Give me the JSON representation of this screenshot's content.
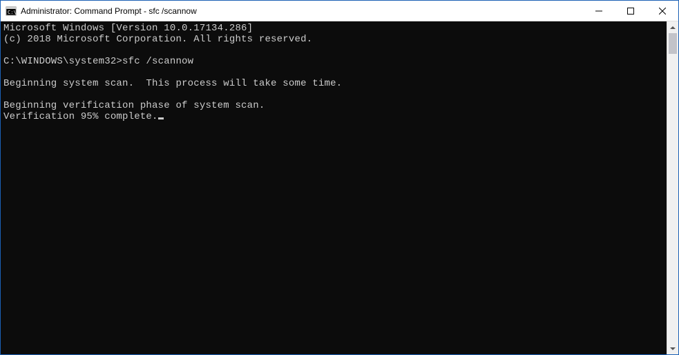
{
  "window": {
    "title": "Administrator: Command Prompt - sfc  /scannow"
  },
  "terminal": {
    "line1": "Microsoft Windows [Version 10.0.17134.286]",
    "line2": "(c) 2018 Microsoft Corporation. All rights reserved.",
    "blank1": "",
    "prompt_line": "C:\\WINDOWS\\system32>sfc /scannow",
    "blank2": "",
    "scan_begin": "Beginning system scan.  This process will take some time.",
    "blank3": "",
    "verify_begin": "Beginning verification phase of system scan.",
    "verify_progress": "Verification 95% complete."
  }
}
